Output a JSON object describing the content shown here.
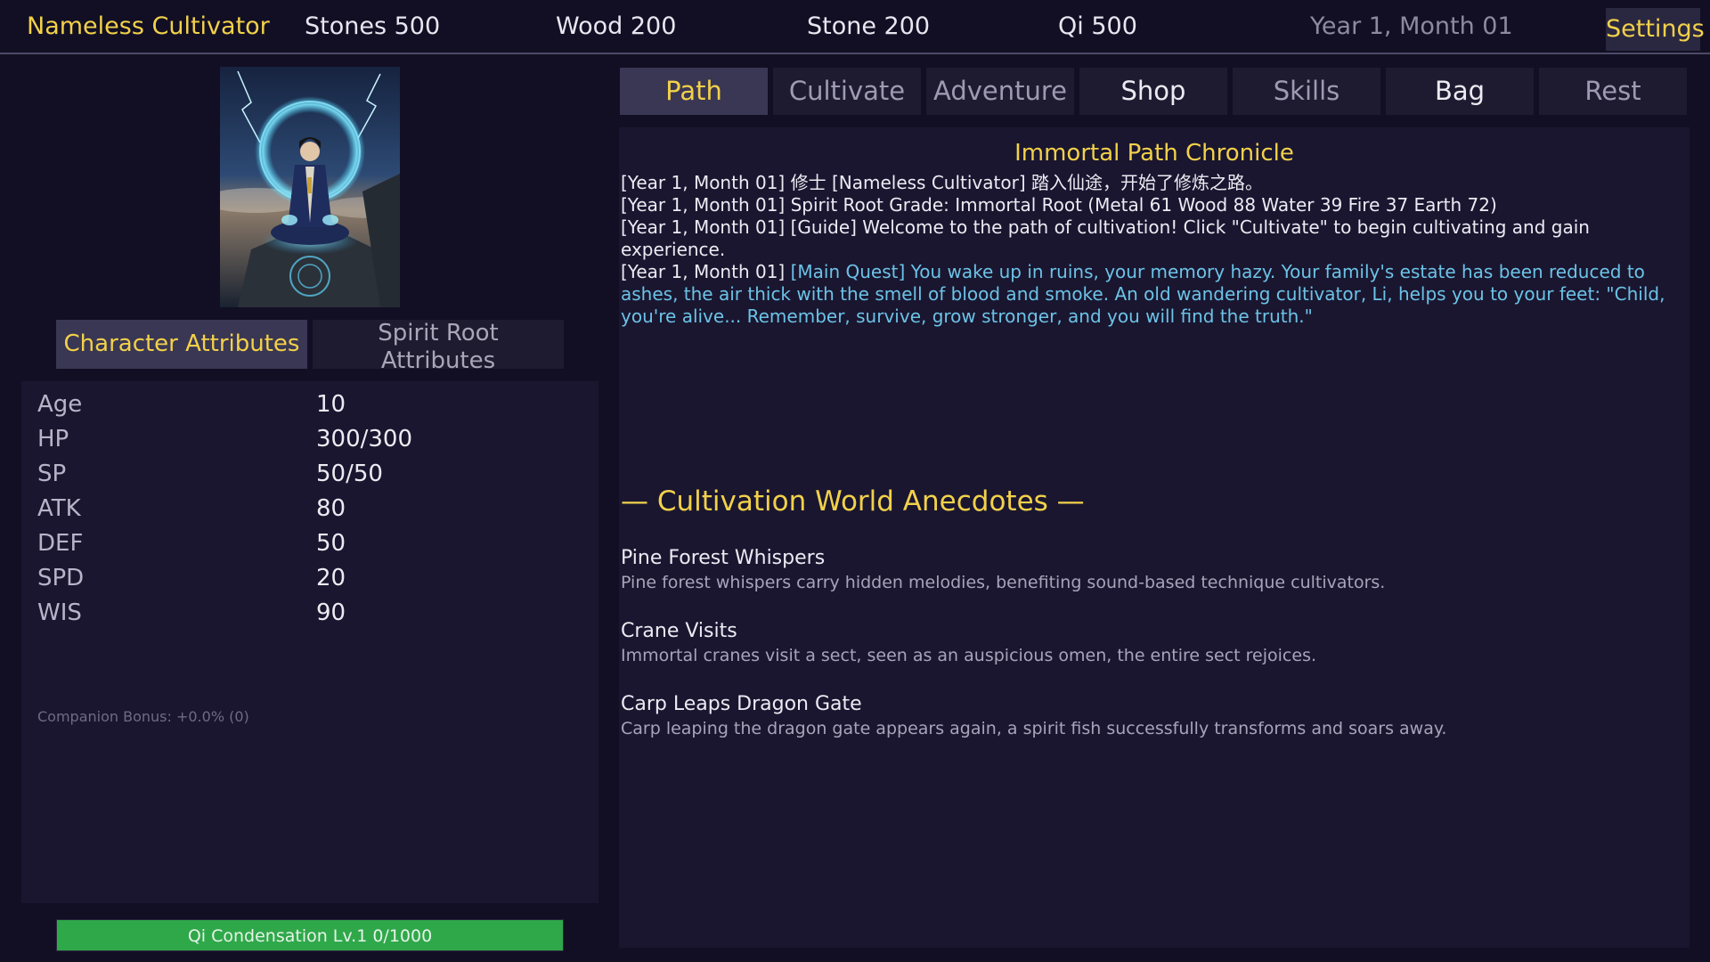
{
  "topbar": {
    "title": "Nameless Cultivator",
    "stones": "Stones 500",
    "wood": "Wood 200",
    "stone": "Stone 200",
    "qi": "Qi 500",
    "date": "Year 1, Month 01",
    "settings_label": "Settings"
  },
  "left": {
    "tabs": {
      "character": "Character Attributes",
      "spirit_root_line1": "Spirit Root",
      "spirit_root_line2": "Attributes"
    },
    "attributes": [
      {
        "key": "Age",
        "value": "10"
      },
      {
        "key": "HP",
        "value": "300/300"
      },
      {
        "key": "SP",
        "value": "50/50"
      },
      {
        "key": "ATK",
        "value": "80"
      },
      {
        "key": "DEF",
        "value": "50"
      },
      {
        "key": "SPD",
        "value": "20"
      },
      {
        "key": "WIS",
        "value": "90"
      }
    ],
    "companion_bonus": "Companion Bonus: +0.0% (0)",
    "realm": {
      "label": "Qi Condensation Lv.1  0/1000",
      "progress": 1.0,
      "color": "#2fa84a"
    }
  },
  "nav": {
    "tabs": [
      "Path",
      "Cultivate",
      "Adventure",
      "Shop",
      "Skills",
      "Bag",
      "Rest"
    ],
    "active": "Path"
  },
  "main": {
    "chronicle_title": "Immortal Path Chronicle",
    "log": [
      {
        "prefix": "[Year 1, Month 01] ",
        "text": "修士 [Nameless Cultivator] 踏入仙途，开始了修炼之路。",
        "quest": ""
      },
      {
        "prefix": "[Year 1, Month 01] ",
        "text": "Spirit Root Grade: Immortal Root (Metal 61 Wood 88 Water 39 Fire 37 Earth 72)",
        "quest": ""
      },
      {
        "prefix": "[Year 1, Month 01] ",
        "text": "[Guide] Welcome to the path of cultivation! Click \"Cultivate\" to begin cultivating and gain experience.",
        "quest": ""
      },
      {
        "prefix": "[Year 1, Month 01] ",
        "text": "",
        "quest": "[Main Quest] You wake up in ruins, your memory hazy. Your family's estate has been reduced to ashes, the air thick with the smell of blood and smoke. An old wandering cultivator, Li, helps you to your feet: \"Child, you're alive... Remember, survive, grow stronger, and you will find the truth.\""
      }
    ],
    "anecdotes_header": "— Cultivation World Anecdotes —",
    "anecdotes": [
      {
        "name": "Pine Forest Whispers",
        "desc": "Pine forest whispers carry hidden melodies, benefiting sound-based technique cultivators."
      },
      {
        "name": "Crane Visits",
        "desc": "Immortal cranes visit a sect, seen as an auspicious omen, the entire sect rejoices."
      },
      {
        "name": "Carp Leaps Dragon Gate",
        "desc": "Carp leaping the dragon gate appears again, a spirit fish successfully transforms and soars away."
      }
    ]
  },
  "colors": {
    "accent": "#f2d14a",
    "quest_text": "#6cc3e6",
    "background": "#120f24",
    "panel": "#1a1630"
  }
}
